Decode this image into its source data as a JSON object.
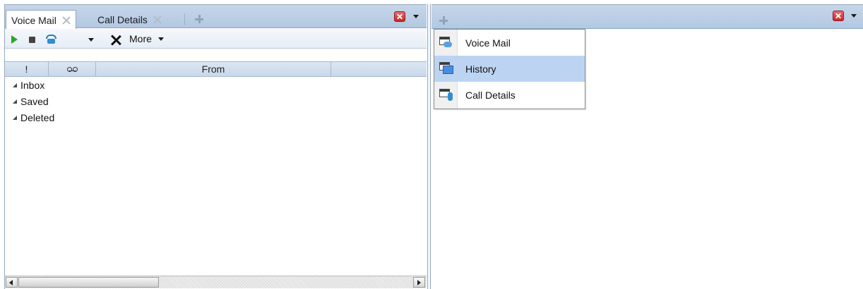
{
  "left_pane": {
    "tabs": [
      {
        "label": "Voice Mail",
        "active": true
      },
      {
        "label": "Call Details",
        "active": false
      }
    ],
    "toolbar": {
      "more_label": "More"
    },
    "table": {
      "columns": [
        {
          "label": "!"
        },
        {
          "icon": "voicemail-icon"
        },
        {
          "label": "From"
        },
        {
          "label": ""
        }
      ]
    },
    "tree": [
      {
        "label": "Inbox"
      },
      {
        "label": "Saved"
      },
      {
        "label": "Deleted"
      }
    ]
  },
  "right_pane": {
    "menu": [
      {
        "label": "Voice Mail",
        "icon": "voice-mail-window-icon",
        "highlighted": false
      },
      {
        "label": "History",
        "icon": "history-window-icon",
        "highlighted": true
      },
      {
        "label": "Call Details",
        "icon": "call-details-window-icon",
        "highlighted": false
      }
    ]
  },
  "colors": {
    "tab_strip": "#b3c8e1",
    "menu_highlight": "#bcd4f2",
    "play_green": "#29a329",
    "close_red": "#c92727"
  }
}
